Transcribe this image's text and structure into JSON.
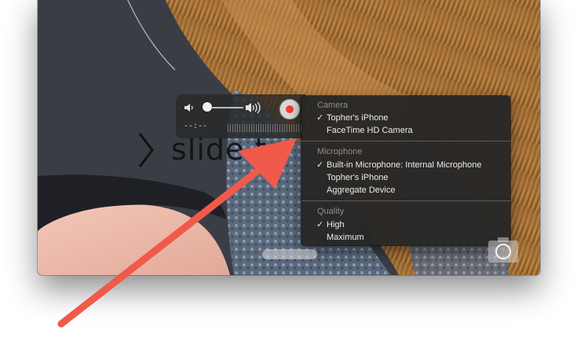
{
  "video": {
    "lock_screen_text": "slide to"
  },
  "hud": {
    "time": "--:--",
    "volume_level": 0.0
  },
  "menu": {
    "sections": [
      {
        "header": "Camera",
        "items": [
          {
            "label": "Topher's iPhone",
            "checked": true
          },
          {
            "label": "FaceTime HD Camera",
            "checked": false
          }
        ]
      },
      {
        "header": "Microphone",
        "items": [
          {
            "label": "Built-in Microphone: Internal Microphone",
            "checked": true
          },
          {
            "label": "Topher's iPhone",
            "checked": false
          },
          {
            "label": "Aggregate Device",
            "checked": false
          }
        ]
      },
      {
        "header": "Quality",
        "items": [
          {
            "label": "High",
            "checked": true
          },
          {
            "label": "Maximum",
            "checked": false
          }
        ]
      }
    ],
    "check_glyph": "✓"
  },
  "colors": {
    "record_red": "#ff3b30",
    "arrow_red": "#f05a4b"
  }
}
